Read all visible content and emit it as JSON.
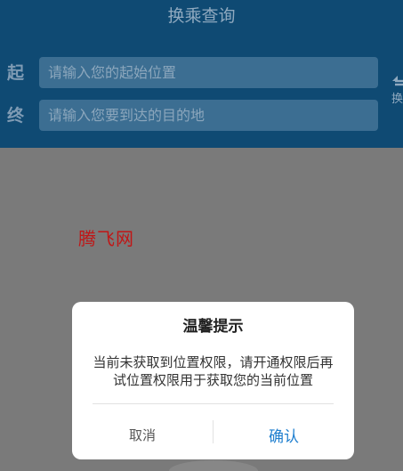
{
  "header": {
    "title": "换乘查询",
    "start_label": "起",
    "end_label": "终",
    "start_placeholder": "请输入您的起始位置",
    "end_placeholder": "请输入您要到达的目的地",
    "swap_label": "换"
  },
  "watermark": "腾飞网",
  "dialog": {
    "title": "温馨提示",
    "message": "当前未获取到位置权限，请开通权限后再试位置权限用于获取您的当前位置",
    "cancel_label": "取消",
    "confirm_label": "确认"
  },
  "colors": {
    "header_background": "#0f4a73",
    "overlay_background": "#7a7a7a",
    "confirm_text": "#1f7fcf",
    "watermark_text": "#c01616"
  },
  "icons": {
    "swap": "swap-arrows-icon"
  }
}
